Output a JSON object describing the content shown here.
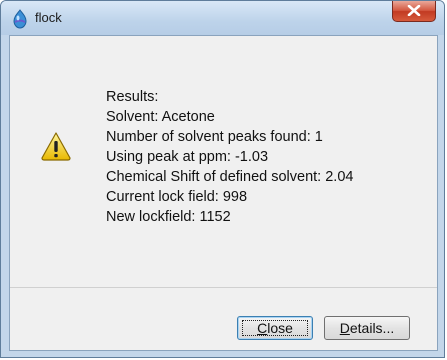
{
  "window": {
    "title": "flock",
    "close_icon": "close-icon"
  },
  "dialog": {
    "icon": "warning-icon",
    "lines": [
      "Results:",
      "Solvent: Acetone",
      "Number of solvent peaks found: 1",
      "Using peak at ppm: -1.03",
      "Chemical Shift of defined solvent: 2.04",
      "Current lock field: 998",
      "New lockfield: 1152"
    ]
  },
  "buttons": {
    "close": {
      "mnemonic": "C",
      "rest": "lose"
    },
    "details": {
      "mnemonic": "D",
      "rest": "etails..."
    }
  }
}
